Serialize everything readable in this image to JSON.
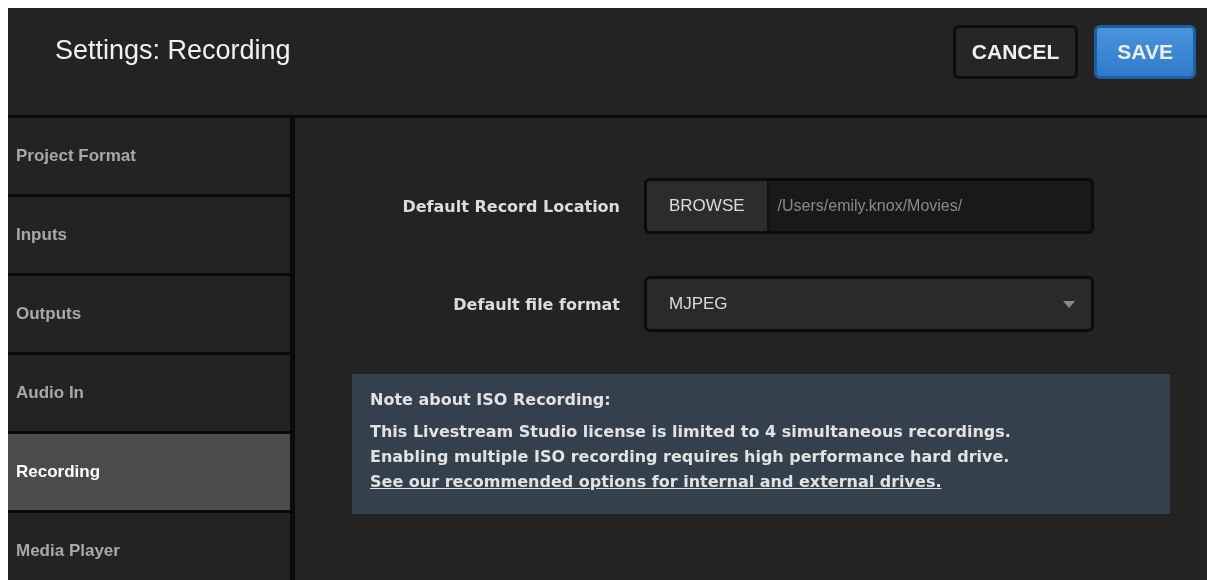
{
  "window": {
    "title": "Settings: Recording"
  },
  "buttons": [
    {
      "label": "CANCEL",
      "kind": "secondary"
    },
    {
      "label": "SAVE",
      "kind": "primary"
    }
  ],
  "sidebar": {
    "items": [
      {
        "label": "Project Format",
        "selected": false
      },
      {
        "label": "Inputs",
        "selected": false
      },
      {
        "label": "Outputs",
        "selected": false
      },
      {
        "label": "Audio In",
        "selected": false
      },
      {
        "label": "Recording",
        "selected": true
      },
      {
        "label": "Media Player",
        "selected": false
      }
    ]
  },
  "fields": [
    {
      "kind": "path",
      "label": "Default Record Location",
      "button": "BROWSE",
      "value": "/Users/emily.knox/Movies/"
    },
    {
      "kind": "select",
      "label": "Default file format",
      "value": "MJPEG"
    }
  ],
  "note": {
    "title": "Note about ISO Recording:",
    "text": "This Livestream Studio license is limited to 4 simultaneous recordings. Enabling multiple ISO recording requires high performance hard drive.",
    "link": "See our recommended options for internal and external drives."
  }
}
